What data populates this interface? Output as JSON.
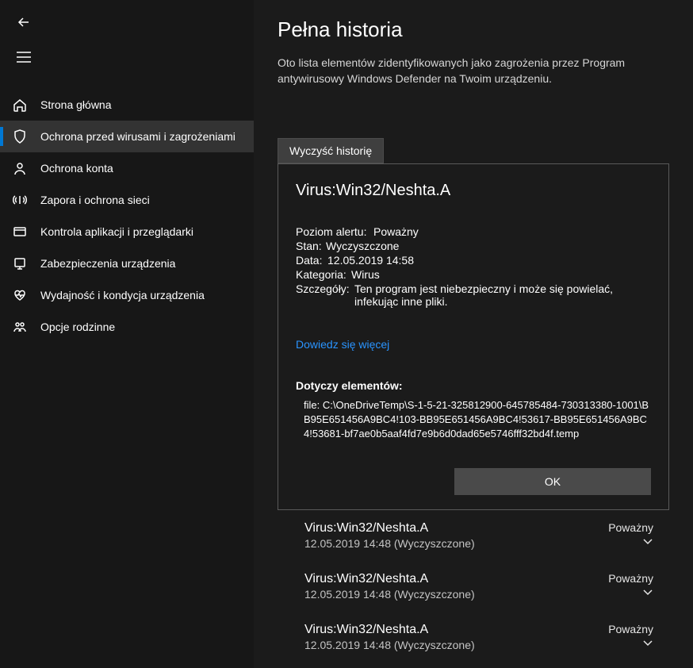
{
  "sidebar": {
    "items": [
      {
        "label": "Strona główna"
      },
      {
        "label": "Ochrona przed wirusami i zagrożeniami"
      },
      {
        "label": "Ochrona konta"
      },
      {
        "label": "Zapora i ochrona sieci"
      },
      {
        "label": "Kontrola aplikacji i przeglądarki"
      },
      {
        "label": "Zabezpieczenia urządzenia"
      },
      {
        "label": "Wydajność i kondycja urządzenia"
      },
      {
        "label": "Opcje rodzinne"
      }
    ]
  },
  "page": {
    "title": "Pełna historia",
    "subtitle": "Oto lista elementów zidentyfikowanych jako zagrożenia przez Program antywirusowy Windows Defender na Twoim urządzeniu."
  },
  "clear_button": "Wyczyść historię",
  "detail": {
    "title": "Virus:Win32/Neshta.A",
    "rows": {
      "alert_label": "Poziom alertu:",
      "alert_value": "Poważny",
      "state_label": "Stan:",
      "state_value": "Wyczyszczone",
      "date_label": "Data:",
      "date_value": "12.05.2019 14:58",
      "cat_label": "Kategoria:",
      "cat_value": "Wirus",
      "det_label": "Szczegóły:",
      "det_value": "Ten program jest niebezpieczny i może się powielać, infekując inne pliki."
    },
    "learn_more": "Dowiedz się więcej",
    "affected_header": "Dotyczy elementów:",
    "filepath": "file: C:\\OneDriveTemp\\S-1-5-21-325812900-645785484-730313380-1001\\BB95E651456A9BC4!103-BB95E651456A9BC4!53617-BB95E651456A9BC4!53681-bf7ae0b5aaf4fd7e9b6d0dad65e5746fff32bd4f.temp",
    "ok": "OK"
  },
  "history": [
    {
      "name": "Virus:Win32/Neshta.A",
      "meta": "12.05.2019 14:48 (Wyczyszczone)",
      "severity": "Poważny"
    },
    {
      "name": "Virus:Win32/Neshta.A",
      "meta": "12.05.2019 14:48 (Wyczyszczone)",
      "severity": "Poważny"
    },
    {
      "name": "Virus:Win32/Neshta.A",
      "meta": "12.05.2019 14:48 (Wyczyszczone)",
      "severity": "Poważny"
    }
  ]
}
